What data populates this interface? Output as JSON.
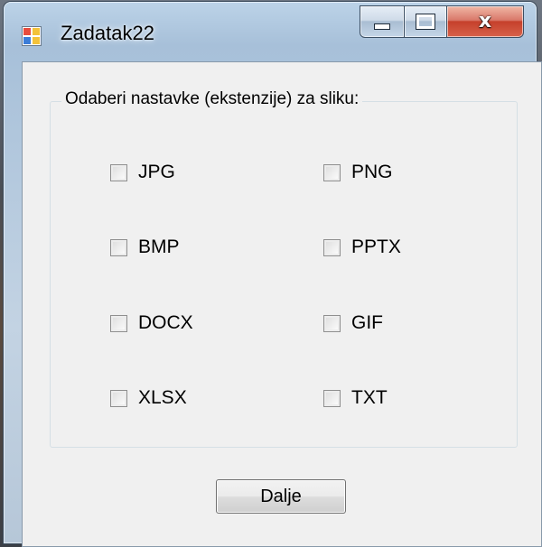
{
  "window": {
    "title": "Zadatak22",
    "close_glyph": "x"
  },
  "group": {
    "legend": "Odaberi nastavke (ekstenzije) za sliku:"
  },
  "checkboxes": [
    {
      "label": "JPG",
      "checked": false
    },
    {
      "label": "PNG",
      "checked": false
    },
    {
      "label": "BMP",
      "checked": false
    },
    {
      "label": "PPTX",
      "checked": false
    },
    {
      "label": "DOCX",
      "checked": false
    },
    {
      "label": "GIF",
      "checked": false
    },
    {
      "label": "XLSX",
      "checked": false
    },
    {
      "label": "TXT",
      "checked": false
    }
  ],
  "buttons": {
    "next_label": "Dalje"
  }
}
